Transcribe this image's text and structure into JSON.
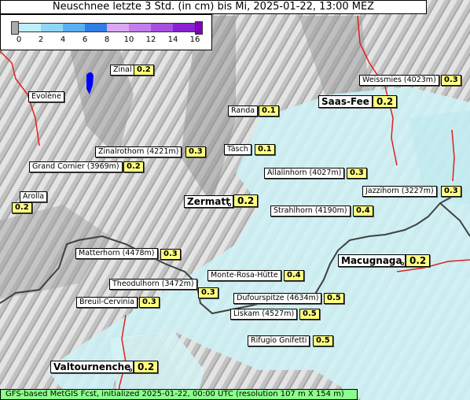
{
  "title": "Neuschnee letzte 3 Std. (in cm) bis Mi, 2025-01-22, 13:00 MEZ",
  "legend": {
    "ticks": [
      "0",
      "2",
      "4",
      "6",
      "8",
      "10",
      "12",
      "14",
      "16"
    ],
    "colors": [
      "#bfefff",
      "#8fd6f5",
      "#5ab0f0",
      "#2f7de6",
      "#d8a8f0",
      "#c37de8",
      "#a64fe0",
      "#8c1ed4"
    ],
    "below_color": "#aaaaaa",
    "above_color": "#8000c0"
  },
  "colors": {
    "terrain_light": "#e6e6e6",
    "terrain_dark": "#8a8a8a",
    "snow_cyan": "#cdf1f5",
    "border_red": "#e02020",
    "border_dark": "#404040",
    "lake_blue": "#0000ff",
    "value_bg": "#ffff80",
    "footer_bg": "#8bff8b"
  },
  "places": [
    {
      "name": "Zinal",
      "value": "0.2"
    },
    {
      "name": "Evolène",
      "value": ""
    },
    {
      "name": "Weissmies (4023m)",
      "value": "0.3"
    },
    {
      "name": "Saas-Fee",
      "value": "0.2"
    },
    {
      "name": "Randa",
      "value": "0.1"
    },
    {
      "name": "Zinalrothorn (4221m)",
      "value": "0.3"
    },
    {
      "name": "Täsch",
      "value": "0.1"
    },
    {
      "name": "Grand Cornier (3969m)",
      "value": "0.2"
    },
    {
      "name": "Allalinhorn (4027m)",
      "value": "0.3"
    },
    {
      "name": "Arolla",
      "value": "0.2"
    },
    {
      "name": "Jazzihorn (3227m)",
      "value": "0.3"
    },
    {
      "name": "Zermatt",
      "value": "0.2"
    },
    {
      "name": "Strahlhorn (4190m)",
      "value": "0.4"
    },
    {
      "name": "Matterhorn (4478m)",
      "value": "0.3"
    },
    {
      "name": "Macugnaga",
      "value": "0.2"
    },
    {
      "name": "Monte-Rosa-Hütte",
      "value": "0.4"
    },
    {
      "name": "Theodulhorn (3472m)",
      "value": "0.3"
    },
    {
      "name": "Breuil-Cervinia",
      "value": "0.3"
    },
    {
      "name": "Dufourspitze (4634m)",
      "value": "0.5"
    },
    {
      "name": "Liskam (4527m)",
      "value": "0.5"
    },
    {
      "name": "Rifugio Gnifetti",
      "value": "0.5"
    },
    {
      "name": "Valtournenche",
      "value": "0.2"
    }
  ],
  "footer": "GFS-based MetGIS Fcst, initialized 2025-01-22, 00:00 UTC  (resolution 107 m X 154 m)"
}
